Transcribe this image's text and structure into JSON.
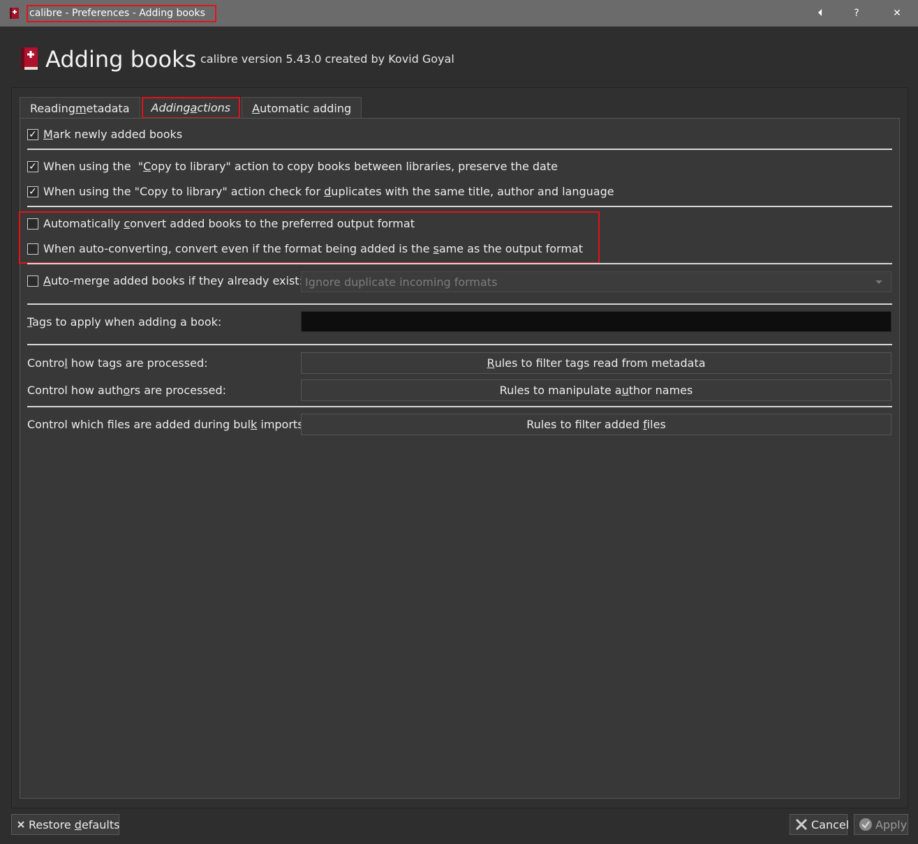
{
  "window": {
    "title": "calibre - Preferences - Adding books",
    "back_glyph": "⏴",
    "help_glyph": "?",
    "close_glyph": "✕"
  },
  "header": {
    "title": "Adding books",
    "subtitle": "calibre version 5.43.0 created by Kovid Goyal"
  },
  "tabs": [
    {
      "pre": "Reading ",
      "u": "m",
      "post": "etadata"
    },
    {
      "pre": "Adding ",
      "u": "a",
      "post": "ctions"
    },
    {
      "pre": "",
      "u": "A",
      "post": "utomatic adding"
    }
  ],
  "options": {
    "mark_new": {
      "checked": "✓",
      "pre": "",
      "u": "M",
      "post": "ark newly added books"
    },
    "preserve_date": {
      "checked": "✓",
      "pre": "When using the  \"",
      "u": "C",
      "post": "opy to library\" action to copy books between libraries, preserve the date"
    },
    "check_duplicates": {
      "checked": "✓",
      "pre": "When using the \"Copy to library\" action check for ",
      "u": "d",
      "post": "uplicates with the same title, author and language"
    },
    "auto_convert": {
      "pre": "Automatically ",
      "u": "c",
      "post": "onvert added books to the preferred output format"
    },
    "convert_same": {
      "pre": "When auto-converting, convert even if the format being added is the ",
      "u": "s",
      "post": "ame as the output format"
    },
    "auto_merge": {
      "pre": "",
      "u": "A",
      "post": "uto-merge added books if they already exist:"
    }
  },
  "auto_merge_select": {
    "value": "Ignore duplicate incoming formats"
  },
  "tags": {
    "pre": "",
    "u": "T",
    "post": "ags to apply when adding a book:",
    "value": ""
  },
  "controls": {
    "tags_label": {
      "pre": "Contro",
      "u": "l",
      "post": " how tags are processed:"
    },
    "tags_button": {
      "pre": "",
      "u": "R",
      "post": "ules to filter tags read from metadata"
    },
    "authors_label": {
      "pre": "Control how auth",
      "u": "o",
      "post": "rs are processed:"
    },
    "authors_button": {
      "pre": "Rules to manipulate a",
      "u": "u",
      "post": "thor names"
    },
    "files_label": {
      "pre": "Control which files are added during bul",
      "u": "k",
      "post": " imports:"
    },
    "files_button": {
      "pre": "Rules to filter added ",
      "u": "f",
      "post": "iles"
    }
  },
  "footer": {
    "restore": {
      "pre": "Restore ",
      "u": "d",
      "post": "efaults"
    },
    "cancel": "Cancel",
    "apply": "Apply"
  },
  "colors": {
    "highlight": "#e0141a",
    "background": "#383838"
  }
}
